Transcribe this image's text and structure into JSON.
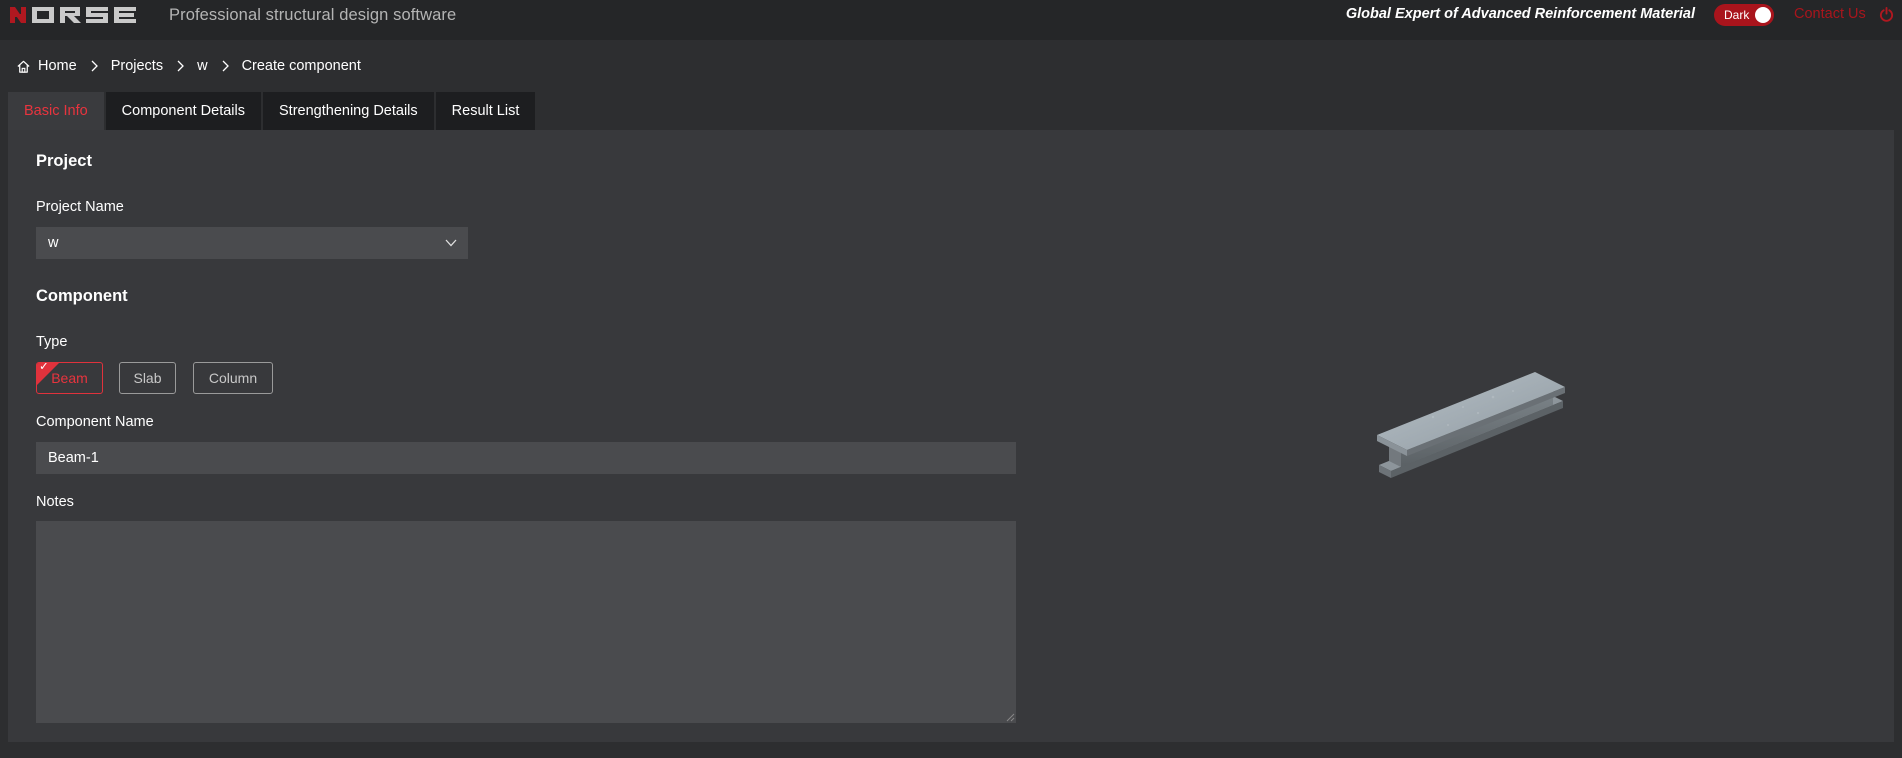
{
  "header": {
    "tagline": "Professional structural design software",
    "slogan": "Global Expert of Advanced Reinforcement Material",
    "theme_toggle_label": "Dark",
    "contact_label": "Contact Us",
    "brand_color": "#a8151c"
  },
  "breadcrumb": [
    "Home",
    "Projects",
    "w",
    "Create component"
  ],
  "tabs": [
    "Basic Info",
    "Component Details",
    "Strengthening Details",
    "Result List"
  ],
  "form": {
    "project_section_title": "Project",
    "project_name_label": "Project Name",
    "project_name_value": "w",
    "component_section_title": "Component",
    "type_label": "Type",
    "types": [
      "Beam",
      "Slab",
      "Column"
    ],
    "selected_type": "Beam",
    "component_name_label": "Component Name",
    "component_name_value": "Beam-1",
    "notes_label": "Notes",
    "notes_value": ""
  },
  "icons": {
    "logo": "horse-logo",
    "power": "power-icon",
    "home": "home-icon",
    "separator": "chevron-right-icon",
    "dropdown": "chevron-down-icon",
    "preview": "i-beam-3d-image"
  },
  "colors": {
    "accent": "#e8343e",
    "panel": "#38393c",
    "input": "#4a4b4e"
  }
}
